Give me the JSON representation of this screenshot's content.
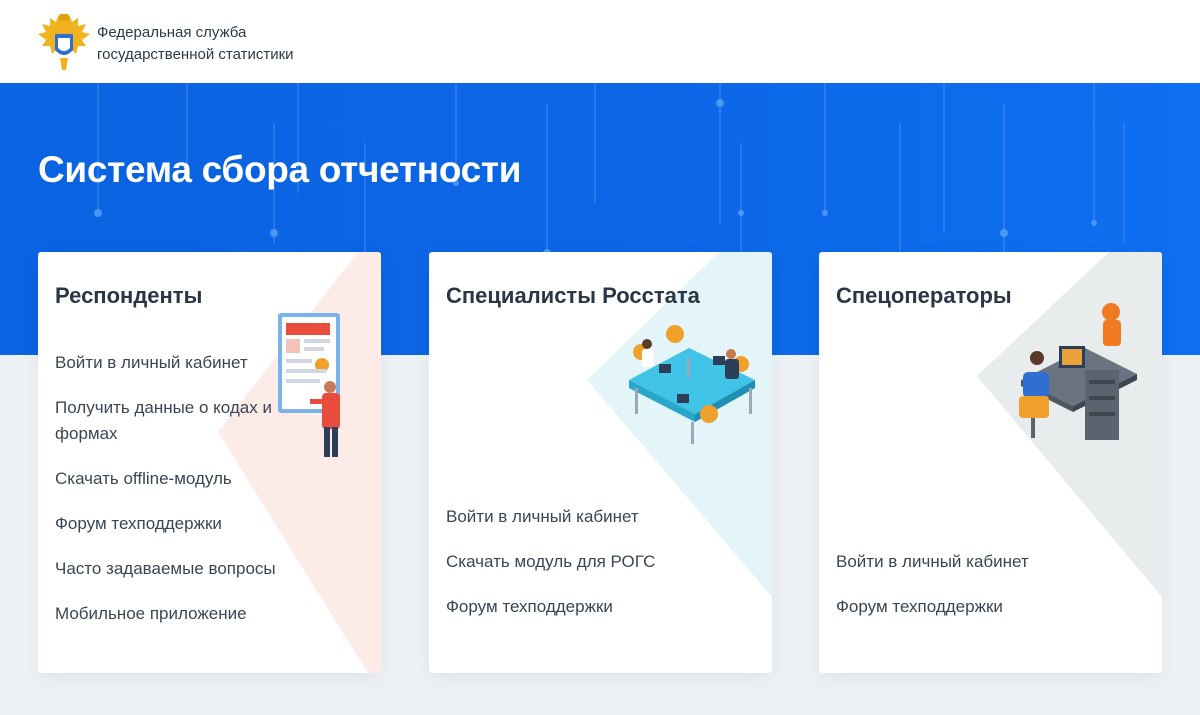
{
  "header": {
    "org_line1": "Федеральная служба",
    "org_line2": "государственной статистики"
  },
  "hero": {
    "title": "Система сбора отчетности"
  },
  "cards": [
    {
      "title": "Респонденты",
      "accent": "#fde8e6",
      "links": [
        "Войти в личный кабинет",
        "Получить данные о кодах и формах",
        "Скачать offline-модуль",
        "Форум техподдержки",
        "Часто задаваемые вопросы",
        "Мобильное приложение"
      ]
    },
    {
      "title": "Специалисты Росстата",
      "accent": "#e3f5f9",
      "links": [
        "Войти в личный кабинет",
        "Скачать модуль для РОГС",
        "Форум техподдержки"
      ]
    },
    {
      "title": "Спецоператоры",
      "accent": "#e6ebea",
      "links": [
        "Войти в личный кабинет",
        "Форум техподдержки"
      ]
    }
  ],
  "icons": {
    "logo": "coat-of-arms-icon",
    "card1": "presentation-board-person-icon",
    "card2": "office-workstations-icon",
    "card3": "operators-desk-icon"
  },
  "colors": {
    "hero": "#0b66e6",
    "page_bg": "#eef1f4",
    "text": "#2d3748"
  }
}
